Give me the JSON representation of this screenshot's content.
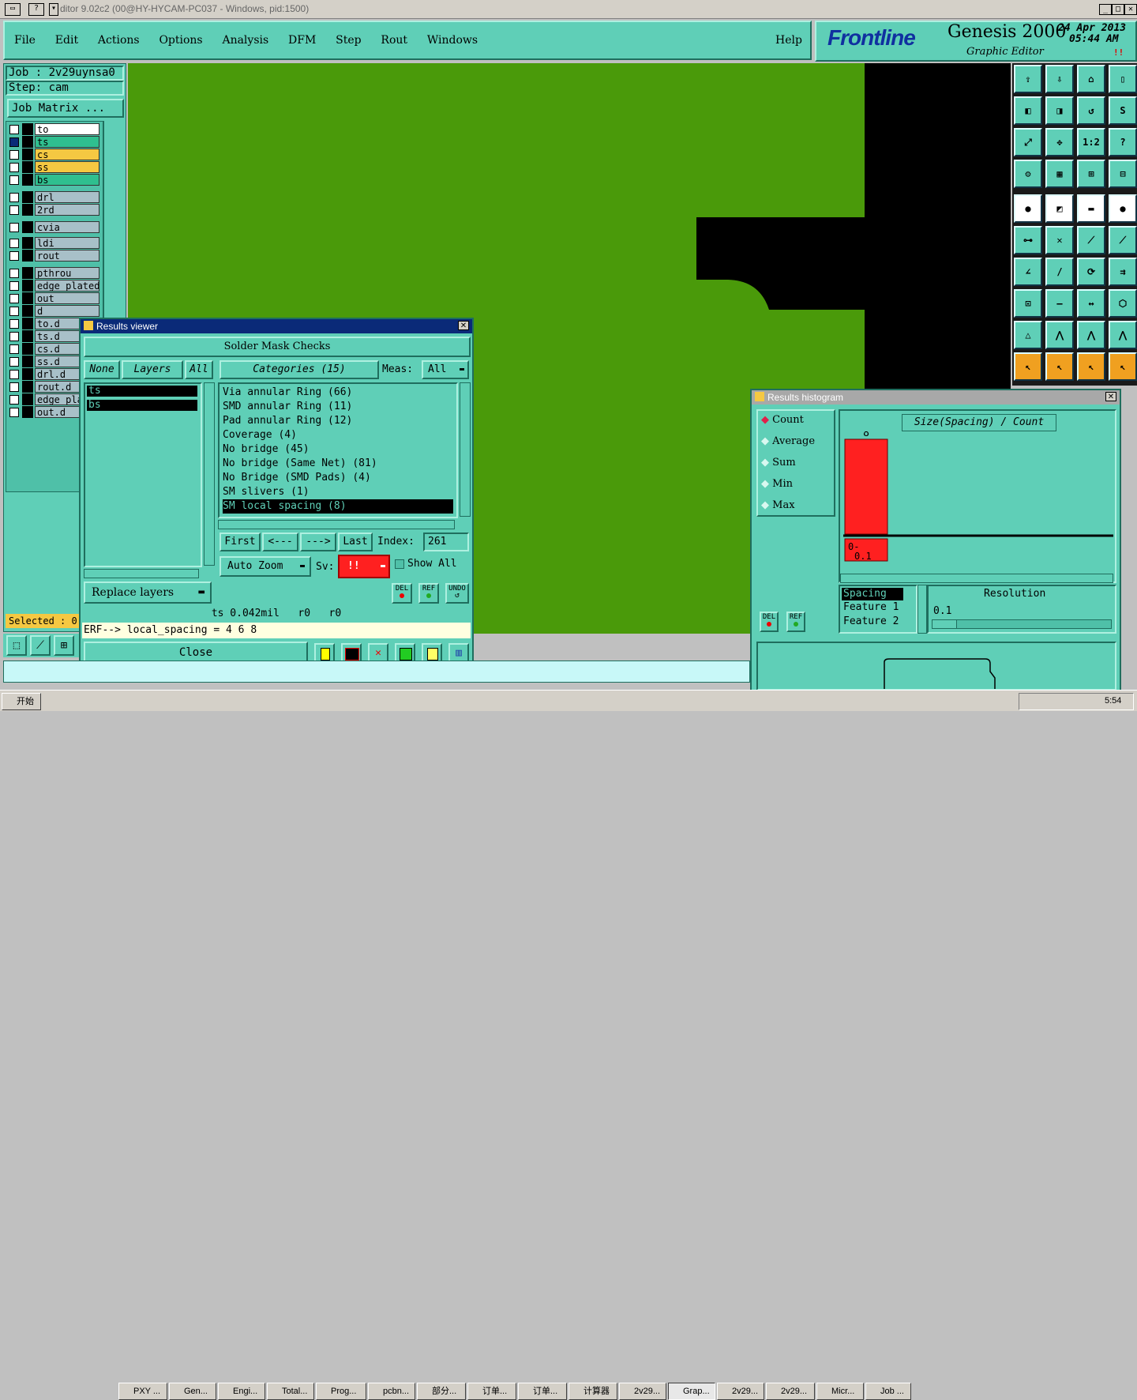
{
  "window": {
    "title": "ditor 9.02c2 (00@HY-HYCAM-PC037 - Windows, pid:1500)"
  },
  "menu": {
    "items": [
      "File",
      "Edit",
      "Actions",
      "Options",
      "Analysis",
      "DFM",
      "Step",
      "Rout",
      "Windows"
    ],
    "help": "Help"
  },
  "brand": {
    "logo": "Frontline",
    "product": "Genesis 2000",
    "subtitle": "Graphic Editor",
    "date": "24 Apr 2013",
    "time": "05:44 AM",
    "indicator": "!!"
  },
  "job": {
    "job_label": "Job : 2v29uynsa0",
    "step_label": "Step: cam",
    "matrix_button": "Job Matrix ..."
  },
  "layers": [
    {
      "name": "to",
      "color": "#ffffff"
    },
    {
      "name": "ts",
      "color": "#2fbf8f",
      "mark": "="
    },
    {
      "name": "cs",
      "color": "#f5c842"
    },
    {
      "name": "ss",
      "color": "#f5c842"
    },
    {
      "name": "bs",
      "color": "#2fbf8f"
    },
    {
      "name": "drl",
      "color": "#a8c0c8"
    },
    {
      "name": "2rd",
      "color": "#a8c0c8"
    },
    {
      "name": "cvia",
      "color": "#a8c0c8"
    },
    {
      "name": "ldi",
      "color": "#a8c0c8"
    },
    {
      "name": "rout",
      "color": "#a8c0c8"
    },
    {
      "name": "pthrou",
      "color": "#a8c0c8"
    },
    {
      "name": "edge_plated",
      "color": "#a8c0c8"
    },
    {
      "name": "out",
      "color": "#a8c0c8"
    },
    {
      "name": "d",
      "color": "#a8c0c8"
    },
    {
      "name": "to.d",
      "color": "#a8c0c8"
    },
    {
      "name": "ts.d",
      "color": "#a8c0c8"
    },
    {
      "name": "cs.d",
      "color": "#a8c0c8"
    },
    {
      "name": "ss.d",
      "color": "#a8c0c8"
    },
    {
      "name": "drl.d",
      "color": "#a8c0c8"
    },
    {
      "name": "rout.d",
      "color": "#a8c0c8"
    },
    {
      "name": "edge_pla",
      "color": "#a8c0c8"
    },
    {
      "name": "out.d",
      "color": "#a8c0c8"
    }
  ],
  "selected": "Selected : 0",
  "results_viewer": {
    "title": "Results viewer",
    "header": "Solder Mask Checks",
    "none_btn": "None",
    "layers_btn": "Layers",
    "all_btn": "All",
    "layer_items": [
      "ts",
      "bs"
    ],
    "categories_btn": "Categories (15)",
    "meas_label": "Meas:",
    "meas_value": "All",
    "categories": [
      "Via annular Ring (66)",
      "SMD annular Ring (11)",
      "Pad annular Ring (12)",
      "Coverage (4)",
      "No bridge (45)",
      "No bridge (Same Net) (81)",
      "No Bridge (SMD Pads) (4)",
      "SM slivers (1)",
      "SM local spacing (8)"
    ],
    "first": "First",
    "prev": "<---",
    "next": "--->",
    "last": "Last",
    "index_label": "Index:",
    "index_value": "261",
    "auto_zoom": "Auto Zoom",
    "sv_label": "Sv:",
    "sv_value": "!!",
    "show_all": "Show All",
    "del": "DEL",
    "ref": "REF",
    "undo": "UNDO",
    "replace_layers": "Replace layers",
    "status": "ts 0.042mil   r0   r0",
    "erf": "ERF--> local_spacing = 4 6 8",
    "close": "Close"
  },
  "histogram": {
    "title": "Results histogram",
    "options": [
      "Count",
      "Average",
      "Sum",
      "Min",
      "Max"
    ],
    "chart_title": "Size(Spacing) / Count",
    "spacing_label": "Spacing",
    "feature1": "Feature 1",
    "feature2": "Feature 2",
    "resolution_label": "Resolution",
    "resolution_value": "0.1",
    "del": "DEL",
    "ref": "REF"
  },
  "chart_data": {
    "type": "bar",
    "categories": [
      "0-0.1"
    ],
    "values": [
      8
    ],
    "title": "Size(Spacing) / Count",
    "bar_color": "#ff2020"
  },
  "taskbar": {
    "start": "开始",
    "items": [
      "PXY ...",
      "Gen...",
      "Engi...",
      "Total...",
      "Prog...",
      "pcbn...",
      "部分...",
      "订单...",
      "订单...",
      "计算器",
      "2v29...",
      "Grap...",
      "2v29...",
      "2v29...",
      "Micr...",
      "Job ..."
    ],
    "clock": "5:54"
  },
  "colors": {
    "board_green": "#4a9a0a",
    "panel_teal": "#5fcfb7",
    "title_blue": "#0a2a78"
  }
}
